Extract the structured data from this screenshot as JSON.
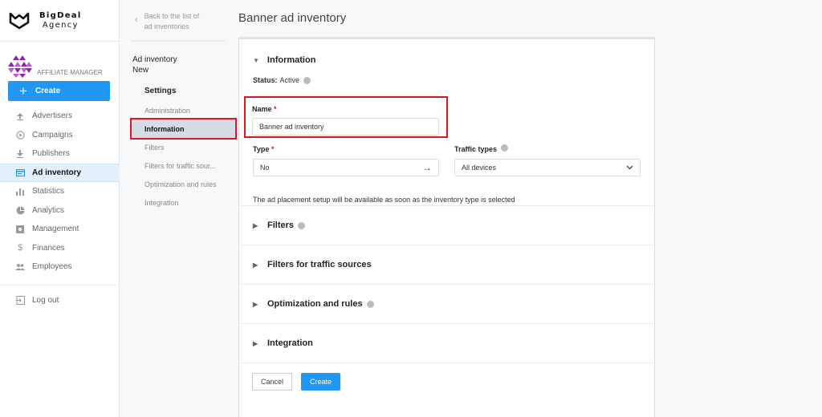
{
  "brand": {
    "line1": "BigDeal",
    "line2": "Agency"
  },
  "user": {
    "role": "AFFILIATE MANAGER"
  },
  "sidebar": {
    "create_label": "Create",
    "items": [
      {
        "label": "Advertisers",
        "icon": "upload-icon"
      },
      {
        "label": "Campaigns",
        "icon": "play-circle-icon"
      },
      {
        "label": "Publishers",
        "icon": "download-icon"
      },
      {
        "label": "Ad inventory",
        "icon": "ad-inventory-icon",
        "active": true
      },
      {
        "label": "Statistics",
        "icon": "bar-chart-icon"
      },
      {
        "label": "Analytics",
        "icon": "pie-chart-icon"
      },
      {
        "label": "Management",
        "icon": "settings-box-icon"
      },
      {
        "label": "Finances",
        "icon": "dollar-icon"
      },
      {
        "label": "Employees",
        "icon": "people-icon"
      }
    ],
    "logout_label": "Log out"
  },
  "subpanel": {
    "back_line1": "Back to the list of",
    "back_line2": "ad inventories",
    "title_line1": "Ad inventory",
    "title_line2": "New",
    "heading": "Settings",
    "items": [
      {
        "label": "Administration"
      },
      {
        "label": "Information",
        "active": true
      },
      {
        "label": "Filters"
      },
      {
        "label": "Filters for traffic sour..."
      },
      {
        "label": "Optimization and rules"
      },
      {
        "label": "Integration"
      }
    ]
  },
  "main": {
    "page_title": "Banner ad inventory",
    "information": {
      "title": "Information",
      "status_label": "Status:",
      "status_value": "Active",
      "name_label": "Name",
      "name_value": "Banner ad inventory",
      "type_label": "Type",
      "type_value": "No",
      "traffic_label": "Traffic types",
      "traffic_value": "All devices",
      "required_mark": "*",
      "note": "The ad placement setup will be available as soon as the inventory type is selected"
    },
    "sections": [
      {
        "title": "Filters",
        "info": true
      },
      {
        "title": "Filters for traffic sources",
        "info": false
      },
      {
        "title": "Optimization and rules",
        "info": true
      },
      {
        "title": "Integration",
        "info": false
      }
    ],
    "cancel_label": "Cancel",
    "create_label": "Create"
  },
  "colors": {
    "accent": "#2196f3",
    "highlight": "#e0161e",
    "brand_purple": "#8e24aa"
  }
}
